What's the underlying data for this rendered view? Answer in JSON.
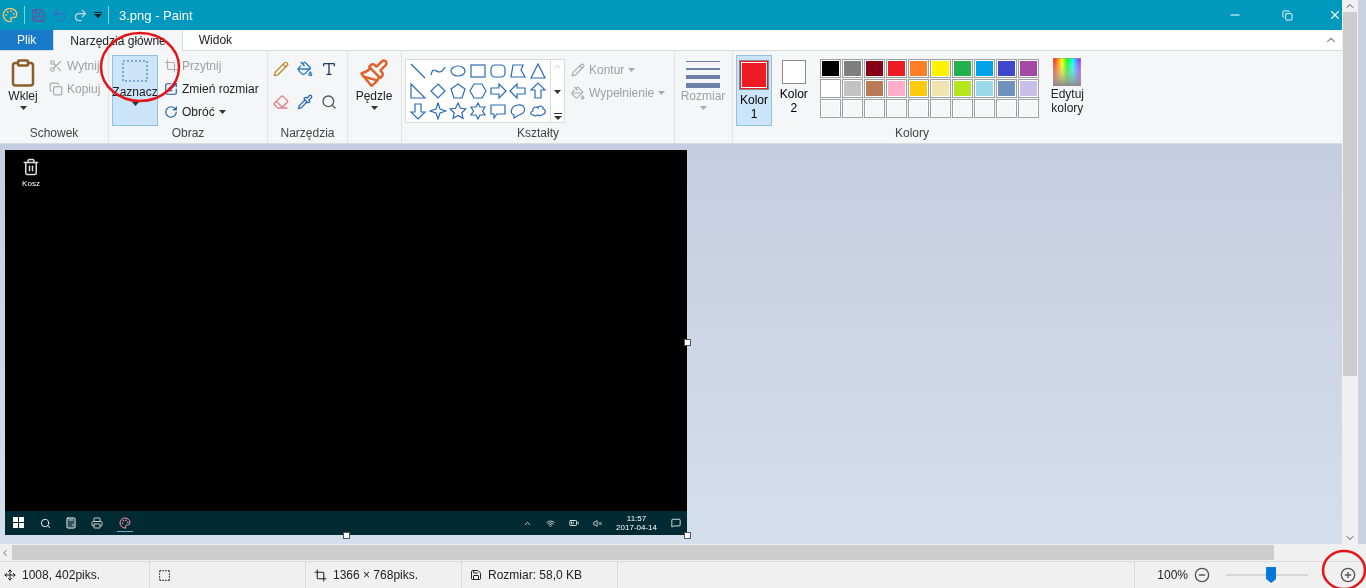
{
  "window": {
    "title": "3.png - Paint"
  },
  "tabs": [
    {
      "label": "Plik",
      "kind": "file",
      "selected": false
    },
    {
      "label": "Narzędzia główne",
      "kind": "tab",
      "selected": true
    },
    {
      "label": "Widok",
      "kind": "tab",
      "selected": false
    }
  ],
  "clipboard": {
    "group": "Schowek",
    "paste": "Wklej",
    "actions": [
      {
        "label": "Wytnij",
        "kind": "cut",
        "disabled": true
      },
      {
        "label": "Kopiuj",
        "kind": "copy",
        "disabled": true
      }
    ]
  },
  "image": {
    "group": "Obraz",
    "select": {
      "label": "Zaznacz",
      "selected": true
    },
    "actions": [
      {
        "label": "Przytnij",
        "kind": "crop",
        "disabled": true
      },
      {
        "label": "Zmień rozmiar",
        "kind": "resize",
        "disabled": false
      },
      {
        "label": "Obróć",
        "kind": "rotate",
        "disabled": false
      }
    ]
  },
  "tools": {
    "group": "Narzędzia"
  },
  "brushes": {
    "label": "Pędzle"
  },
  "shapes": {
    "group": "Kształty",
    "options": [
      {
        "label": "Kontur",
        "kind": "outline",
        "disabled": true
      },
      {
        "label": "Wypełnienie",
        "kind": "fill",
        "disabled": true
      }
    ]
  },
  "size": {
    "label": "Rozmiar",
    "disabled": true
  },
  "colors": {
    "group": "Kolory",
    "slots": [
      {
        "label": "Kolor 1",
        "color": "#ed1c24",
        "selected": true
      },
      {
        "label": "Kolor 2",
        "color": "#ffffff",
        "selected": false
      }
    ],
    "palette": [
      {
        "kind": "color",
        "color": "#000000"
      },
      {
        "kind": "color",
        "color": "#7f7f7f"
      },
      {
        "kind": "color",
        "color": "#880015"
      },
      {
        "kind": "color",
        "color": "#ed1c24"
      },
      {
        "kind": "color",
        "color": "#ff7f27"
      },
      {
        "kind": "color",
        "color": "#fff200"
      },
      {
        "kind": "color",
        "color": "#22b14c"
      },
      {
        "kind": "color",
        "color": "#00a2e8"
      },
      {
        "kind": "color",
        "color": "#3f48cc"
      },
      {
        "kind": "color",
        "color": "#a349a4"
      },
      {
        "kind": "color",
        "color": "#ffffff"
      },
      {
        "kind": "color",
        "color": "#c3c3c3"
      },
      {
        "kind": "color",
        "color": "#b97a57"
      },
      {
        "kind": "color",
        "color": "#ffaec9"
      },
      {
        "kind": "color",
        "color": "#ffc90e"
      },
      {
        "kind": "color",
        "color": "#efe4b0"
      },
      {
        "kind": "color",
        "color": "#b5e61d"
      },
      {
        "kind": "color",
        "color": "#99d9ea"
      },
      {
        "kind": "color",
        "color": "#7092be"
      },
      {
        "kind": "color",
        "color": "#c8bfe7"
      },
      {
        "kind": "empty"
      },
      {
        "kind": "empty"
      },
      {
        "kind": "empty"
      },
      {
        "kind": "empty"
      },
      {
        "kind": "empty"
      },
      {
        "kind": "empty"
      },
      {
        "kind": "empty"
      },
      {
        "kind": "empty"
      },
      {
        "kind": "empty"
      },
      {
        "kind": "empty"
      }
    ],
    "edit": "Edytuj kolory"
  },
  "canvas": {
    "desktop": {
      "icon_label": "Kosz",
      "time": "11:57",
      "date": "2017-04-14"
    }
  },
  "status_bar": {
    "cursor": "1008, 402piks.",
    "image_size": "1366 × 768piks.",
    "file_size": "Rozmiar: 58,0 KB",
    "zoom": "100%",
    "zoom_slider": {
      "level": 0.55
    }
  }
}
